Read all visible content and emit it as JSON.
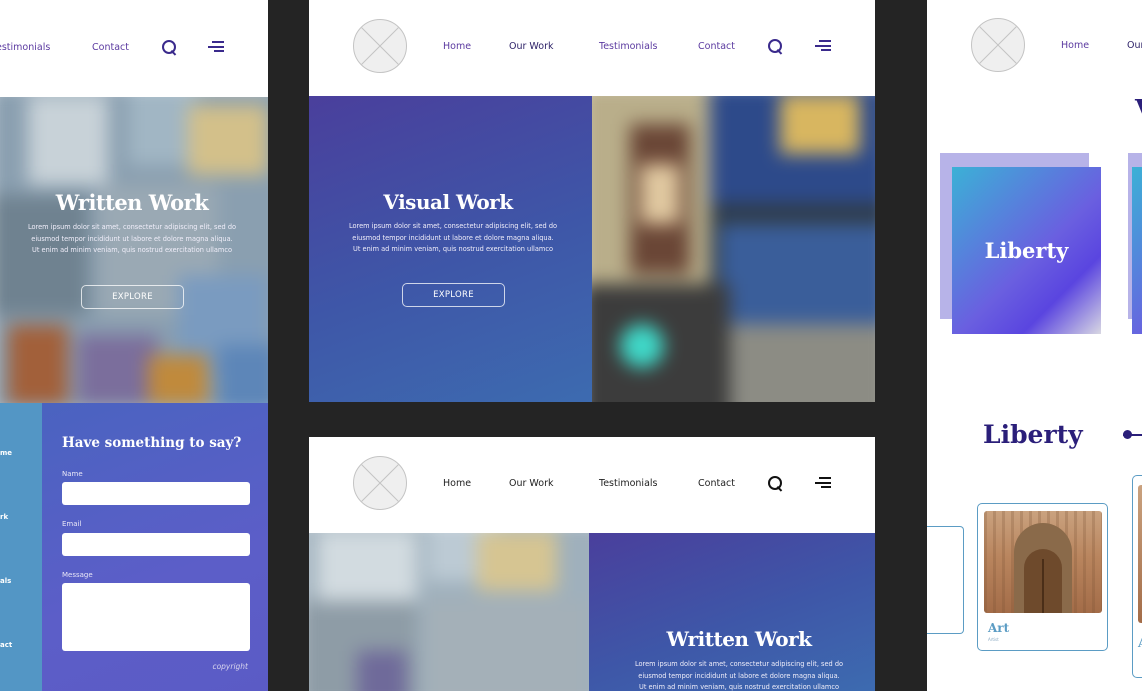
{
  "nav": {
    "home": "Home",
    "our_work": "Our Work",
    "testimonials": "Testimonials",
    "contact": "Contact",
    "left_partial_testimonials": "estimonials",
    "right_partial_our_work": "Our"
  },
  "left_panel": {
    "hero_title": "Written Work",
    "hero_body": [
      "Lorem ipsum dolor sit amet, consectetur adipiscing elit, sed do",
      "eiusmod tempor incididunt ut labore et dolore magna aliqua.",
      "Ut enim ad minim veniam, quis nostrud exercitation ullamco"
    ],
    "explore_label": "EXPLORE",
    "side_labels": [
      "me",
      "rk",
      "als",
      "act"
    ],
    "form": {
      "heading": "Have something to say?",
      "name_label": "Name",
      "email_label": "Email",
      "message_label": "Message",
      "copyright": "copyright"
    }
  },
  "mid_top": {
    "hero_title": "Visual Work",
    "hero_body": [
      "Lorem ipsum dolor sit amet, consectetur adipiscing elit, sed do",
      "eiusmod tempor incididunt ut labore et dolore magna aliqua.",
      "Ut enim ad minim veniam, quis nostrud exercitation ullamco"
    ],
    "explore_label": "EXPLORE"
  },
  "mid_bottom": {
    "hero_title": "Written Work",
    "hero_body": [
      "Lorem ipsum dolor sit amet, consectetur adipiscing elit, sed do",
      "eiusmod tempor incididunt ut labore et dolore magna aliqua.",
      "Ut enim ad minim veniam, quis nostrud exercitation ullamco"
    ]
  },
  "right_panel": {
    "card_title": "Liberty",
    "section_heading": "Liberty",
    "art_card_title": "Art",
    "art_card_sub": "Artist",
    "partial_heading_char": "V",
    "partial_card_char": "A"
  },
  "colors": {
    "background": "#242424",
    "nav_text": "#5b3aa0",
    "hero_gradient_start": "#4a3f9c",
    "hero_gradient_end": "#3d6bb0",
    "form_bg": "#5a60c6",
    "side_bg": "#5396c5",
    "heading_purple": "#2b1f7a",
    "card_blue": "#5b9cc4"
  },
  "icons": [
    "search-icon",
    "menu-icon",
    "logo-placeholder"
  ]
}
